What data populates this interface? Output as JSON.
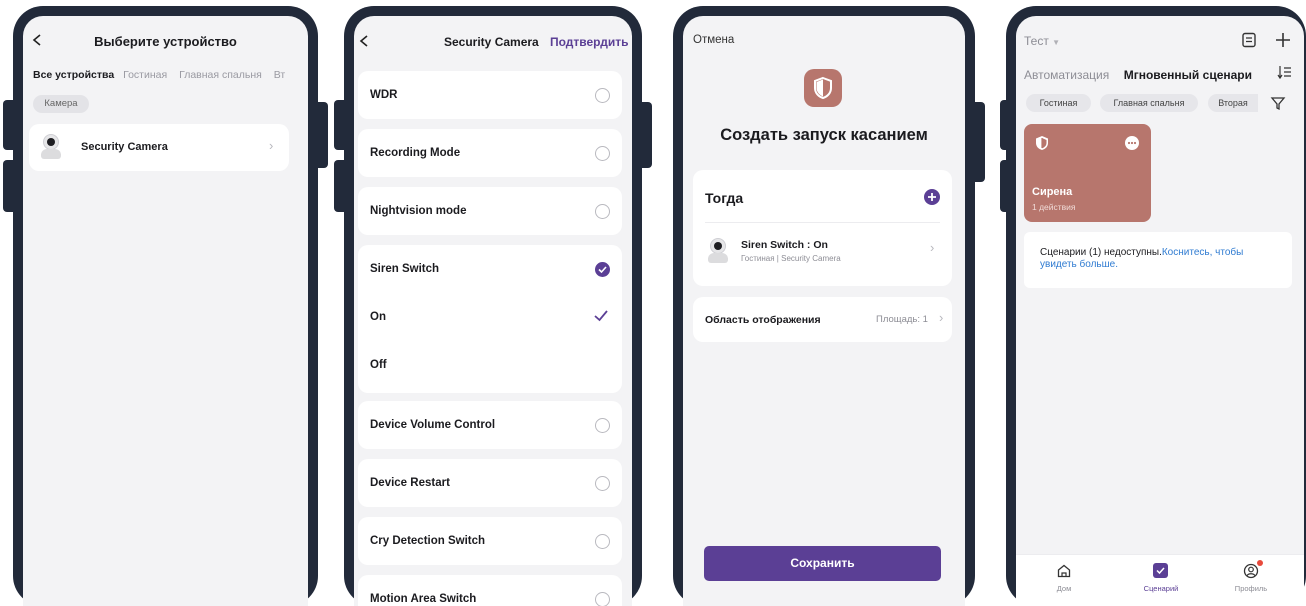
{
  "colors": {
    "accent": "#5b3f95",
    "scene_tile": "#b7766d",
    "link": "#2f7bd1",
    "frame": "#222a3a"
  },
  "s1": {
    "back_icon": "chevron-left-icon",
    "title": "Выберите устройство",
    "tabs": [
      "Все устройства",
      "Гостиная",
      "Главная спальня",
      "Вт"
    ],
    "chip": "Камера",
    "device": {
      "name": "Security Camera",
      "icon": "camera-icon"
    }
  },
  "s2": {
    "title": "Security Camera",
    "confirm": "Подтвердить",
    "rows": {
      "wdr": "WDR",
      "recording": "Recording Mode",
      "nightvision": "Nightvision mode",
      "siren": "Siren Switch",
      "on": "On",
      "off": "Off",
      "volume": "Device Volume Control",
      "restart": "Device Restart",
      "cry": "Cry Detection Switch",
      "motion": "Motion Area Switch"
    }
  },
  "s3": {
    "cancel": "Отмена",
    "heading": "Создать запуск касанием",
    "then_label": "Тогда",
    "action_title": "Siren Switch : On",
    "action_sub": "Гостиная | Security Camera",
    "area_label": "Область отображения",
    "area_value": "Площадь: 1",
    "save": "Сохранить"
  },
  "s4": {
    "home_name": "Тест",
    "tabs": [
      "Автоматизация",
      "Мгновенный сценари"
    ],
    "rooms": [
      "Гостиная",
      "Главная спальня",
      "Вторая"
    ],
    "scene_name": "Сирена",
    "scene_sub": "1 действия",
    "notice_text": "Сценарии (1) недоступны.",
    "notice_link": "Коснитесь, чтобы увидеть больше.",
    "nav": [
      "Дом",
      "Сценарий",
      "Профиль"
    ]
  }
}
